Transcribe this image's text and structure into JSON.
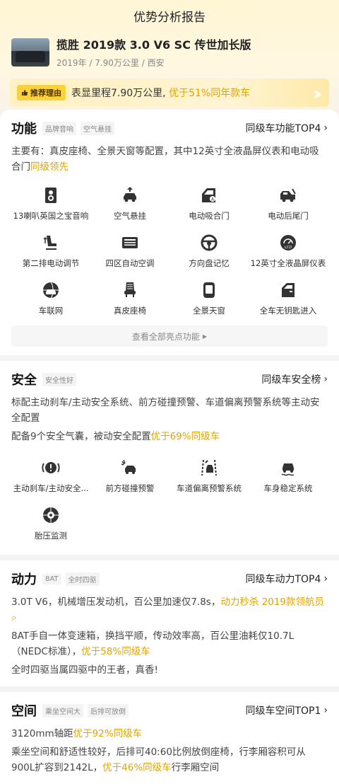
{
  "header": {
    "title": "优势分析报告"
  },
  "car": {
    "title": "揽胜 2019款 3.0 V6 SC 传世加长版",
    "meta": "2019年 / 7.90万公里 / 西安"
  },
  "recommend": {
    "badge": "推荐理由",
    "text": "表显里程7.90万公里, ",
    "highlight": "优于51%同年款车"
  },
  "function": {
    "title": "功能",
    "tags": [
      "品牌音响",
      "空气悬挂"
    ],
    "link": "同级车功能TOP4",
    "desc": "主要有：真皮座椅、全景天窗等配置，其中12英寸全液晶屏仪表和电动吸合门",
    "desc_hl": "同级领先",
    "items": [
      {
        "icon": "speaker-icon",
        "label": "13喇叭英国之宝音响"
      },
      {
        "icon": "air-suspension-icon",
        "label": "空气悬挂"
      },
      {
        "icon": "electric-door-icon",
        "label": "电动吸合门"
      },
      {
        "icon": "electric-tailgate-icon",
        "label": "电动后尾门"
      },
      {
        "icon": "rear-seat-adjust-icon",
        "label": "第二排电动调节"
      },
      {
        "icon": "climate-control-icon",
        "label": "四区自动空调"
      },
      {
        "icon": "steering-memory-icon",
        "label": "方向盘记忆"
      },
      {
        "icon": "lcd-cluster-icon",
        "label": "12英寸全液晶屏仪表"
      },
      {
        "icon": "connected-car-icon",
        "label": "车联网"
      },
      {
        "icon": "leather-seat-icon",
        "label": "真皮座椅"
      },
      {
        "icon": "panoramic-roof-icon",
        "label": "全景天窗"
      },
      {
        "icon": "keyless-entry-icon",
        "label": "全车无钥匙进入"
      }
    ],
    "more": "查看全部亮点功能"
  },
  "safety": {
    "title": "安全",
    "tags": [
      "安全性好"
    ],
    "link": "同级车安全榜",
    "desc1": "标配主动刹车/主动安全系统、前方碰撞预警、车道偏离预警系统等主动安全配置",
    "desc2": "配备9个安全气囊，被动安全配置",
    "desc2_hl": "优于69%同级车",
    "items": [
      {
        "icon": "active-brake-icon",
        "label": "主动刹车/主动安全..."
      },
      {
        "icon": "collision-warning-icon",
        "label": "前方碰撞预警"
      },
      {
        "icon": "lane-departure-icon",
        "label": "车道偏离预警系统"
      },
      {
        "icon": "stability-icon",
        "label": "车身稳定系统"
      },
      {
        "icon": "tire-pressure-icon",
        "label": "胎压监测"
      }
    ]
  },
  "power": {
    "title": "动力",
    "tags": [
      "8AT",
      "全时四驱"
    ],
    "link": "同级车动力TOP4",
    "line1": "3.0T V6，机械增压发动机，百公里加速仅7.8s，",
    "line1_hl": "动力秒杀 2019款领航员",
    "line2": "8AT手自一体变速箱，换挡平顺，传动效率高，百公里油耗仅10.7L（NEDC标准），",
    "line2_hl": "优于58%同级车",
    "line3": "全时四驱当属四驱中的王者，真香!"
  },
  "space": {
    "title": "空间",
    "tags": [
      "乘坐空间大",
      "后排可放倒"
    ],
    "link": "同级车空间TOP1",
    "line1": "3120mm轴距",
    "line1_hl": "优于92%同级车",
    "line2": "乘坐空间和舒适性较好，后排可40:60比例放倒座椅，行李厢容积可从900L扩容到2142L，",
    "line2_hl": "优于46%同级车",
    "line2_tail": "行李厢空间"
  },
  "colors": {
    "accent": "#e1a400",
    "badge": "#fcd23b"
  }
}
